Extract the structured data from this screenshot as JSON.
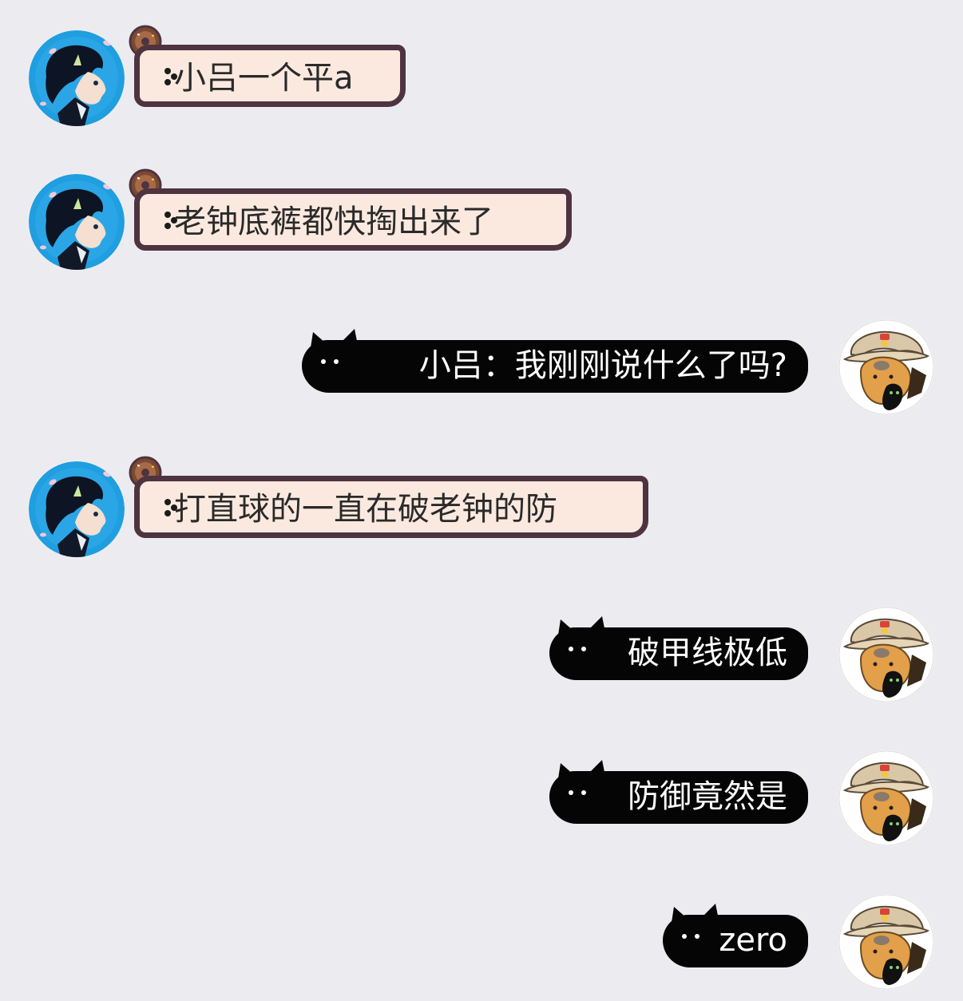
{
  "messages": [
    {
      "direction": "incoming",
      "text": "小吕一个平a",
      "avatar": "anime-boy-avatar"
    },
    {
      "direction": "incoming",
      "text": "老钟底裤都快掏出来了",
      "avatar": "anime-boy-avatar"
    },
    {
      "direction": "outgoing",
      "text": "小吕：我刚刚说什么了吗?",
      "avatar": "capybara-avatar"
    },
    {
      "direction": "incoming",
      "text": "打直球的一直在破老钟的防",
      "avatar": "anime-boy-avatar"
    },
    {
      "direction": "outgoing",
      "text": "破甲线极低",
      "avatar": "capybara-avatar"
    },
    {
      "direction": "outgoing",
      "text": "防御竟然是",
      "avatar": "capybara-avatar"
    },
    {
      "direction": "outgoing",
      "text": "zero",
      "avatar": "capybara-avatar"
    }
  ],
  "colors": {
    "background": "#ececf0",
    "incoming_fill": "#fbe9df",
    "incoming_border": "#4e3340",
    "outgoing_fill": "#050505",
    "incoming_text": "#2a2a2a",
    "outgoing_text": "#ffffff",
    "avatar_blue": "#1f9ee0"
  }
}
